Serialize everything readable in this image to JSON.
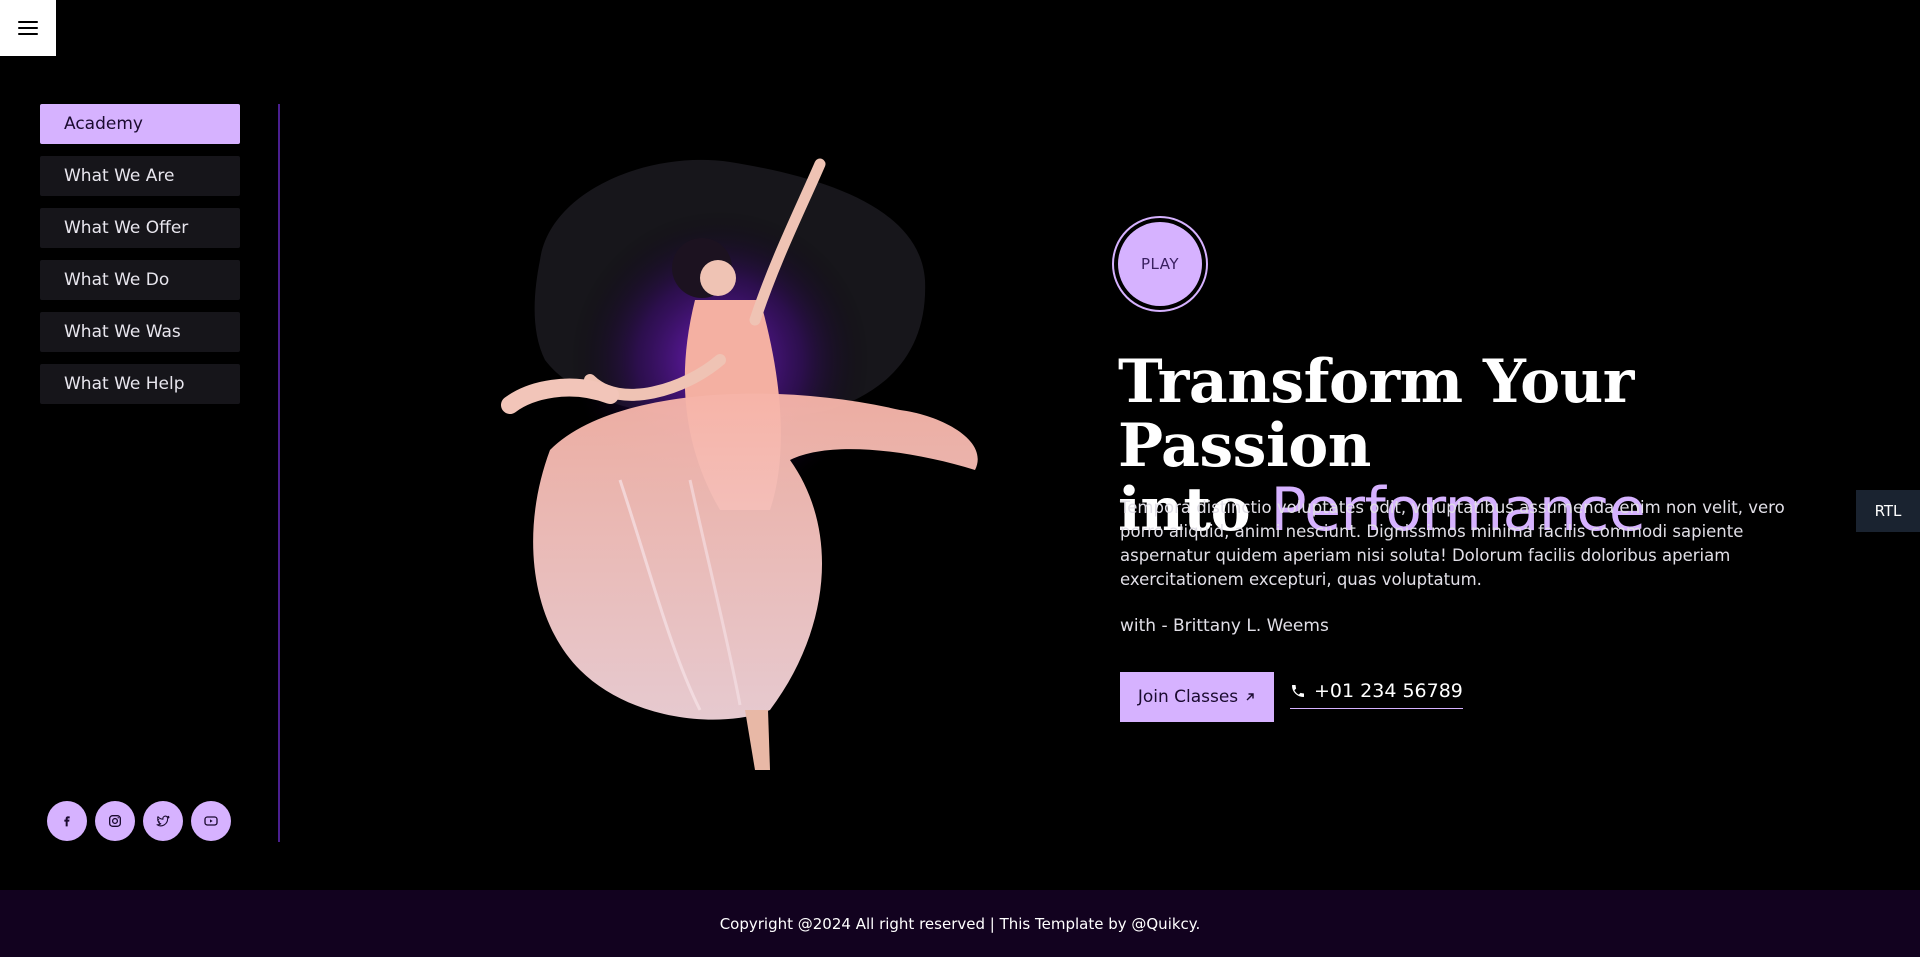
{
  "nav": {
    "menu_icon": "hamburger-icon",
    "items": [
      {
        "label": "Academy",
        "active": true
      },
      {
        "label": "What We Are",
        "active": false
      },
      {
        "label": "What We Offer",
        "active": false
      },
      {
        "label": "What We Do",
        "active": false
      },
      {
        "label": "What We Was",
        "active": false
      },
      {
        "label": "What We Help",
        "active": false
      }
    ]
  },
  "socials": [
    {
      "icon": "facebook-icon"
    },
    {
      "icon": "instagram-icon"
    },
    {
      "icon": "twitter-icon"
    },
    {
      "icon": "youtube-icon"
    }
  ],
  "hero": {
    "play_label": "PLAY",
    "headline_main": "Transform Your Passion",
    "headline_into": "into",
    "headline_accent": "Performance",
    "description": "Tempora distinctio voluptates odit, voluptatibus assumenda enim non velit, vero porro aliquid, animi nesciunt. Dignissimos minima facilis commodi sapiente aspernatur quidem aperiam nisi soluta! Dolorum facilis doloribus aperiam exercitationem excepturi, quas voluptatum.",
    "byline": "with - Brittany L. Weems",
    "join_label": "Join Classes",
    "phone": "+01 234 56789"
  },
  "rtl_label": "RTL",
  "footer": {
    "copyright": "Copyright @2024 All right reserved | This Template by @Quikcy."
  },
  "colors": {
    "accent": "#d6b2ff",
    "footer_bg": "#12021f",
    "divider": "#4a1f8f"
  }
}
